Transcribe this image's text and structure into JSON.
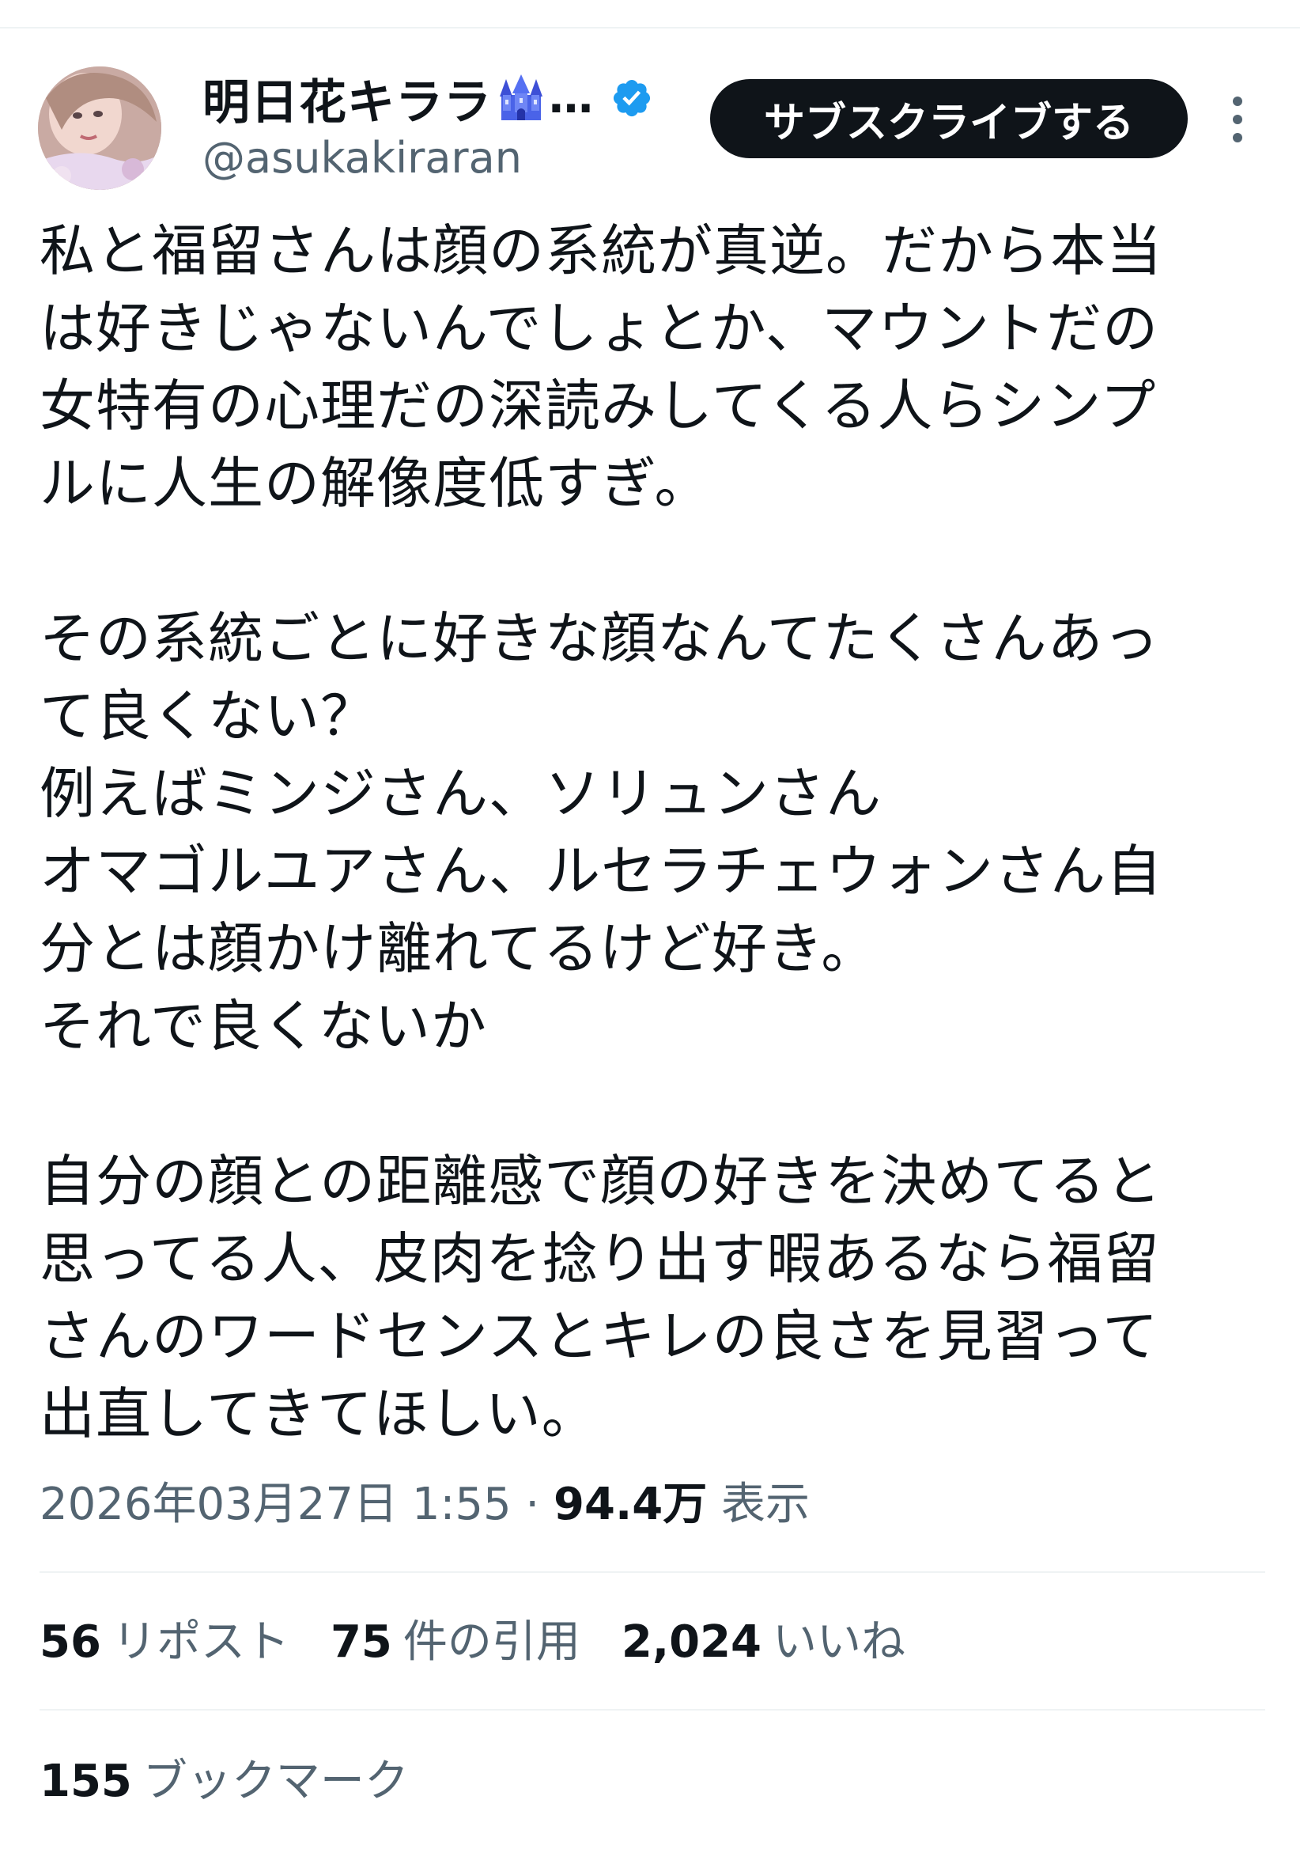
{
  "author": {
    "display_name": "明日花キララ",
    "display_name_ellipsis": "…",
    "name_emoji_icon": "castle-icon",
    "handle": "@asukakiraran",
    "verified_badge_icon": "verified-icon",
    "verified_color": "#1d9bf0"
  },
  "header": {
    "subscribe_label": "サブスクライブする",
    "more_icon": "more-vertical-icon"
  },
  "tweet": {
    "paragraphs": [
      "私と福留さんは顔の系統が真逆。だから本当\nは好きじゃないんでしょとか、マウントだの\n女特有の心理だの深読みしてくる人らシンプ\nルに人生の解像度低すぎ。",
      "その系統ごとに好きな顔なんてたくさんあっ\nて良くない？\n例えばミンジさん、ソリュンさん\nオマゴルユアさん、ルセラチェウォンさん自\n分とは顔かけ離れてるけど好き。\nそれで良くないか",
      "自分の顔との距離感で顔の好きを決めてると\n思ってる人、皮肉を捻り出す暇あるなら福留\nさんのワードセンスとキレの良さを見習って\n出直してきてほしい。"
    ]
  },
  "meta": {
    "timestamp": "2026年03月27日 1:55",
    "separator": "·",
    "views_count": "94.4万",
    "views_label": "表示"
  },
  "stats": {
    "reposts_count": "56",
    "reposts_label": "リポスト",
    "quotes_count": "75",
    "quotes_label": "件の引用",
    "likes_count": "2,024",
    "likes_label": "いいね",
    "bookmarks_count": "155",
    "bookmarks_label": "ブックマーク"
  },
  "colors": {
    "text_primary": "#0f1419",
    "text_secondary": "#536471",
    "divider": "#eff3f4",
    "button_bg": "#0f1419",
    "button_text": "#ffffff"
  }
}
